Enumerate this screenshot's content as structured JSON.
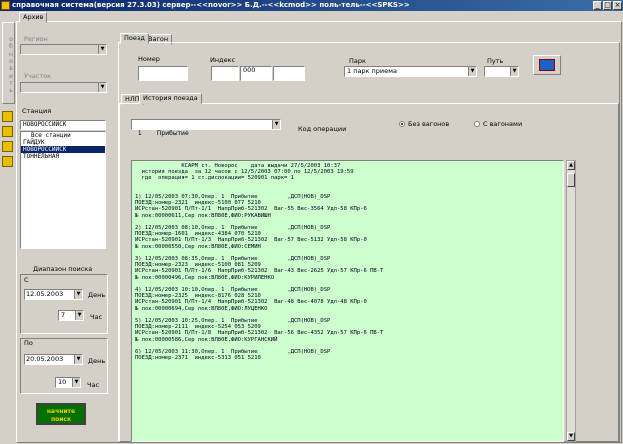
{
  "window": {
    "title": "справочная система(версия 27.3.03) сервер--<<novor>> Б.Д.--<<kcmod>> поль-тель--<<SPKS>>",
    "min": "_",
    "max": "□",
    "close": "×"
  },
  "top_tabs": [
    "Архив"
  ],
  "sidebar": {
    "vertical_button": [
      "о",
      "б",
      "н",
      "о",
      "в",
      "и",
      "т",
      "ь"
    ],
    "region_label": "Регион",
    "area_label": "Участок",
    "station_label": "Станция",
    "station_value": "НОВОРОССИЙСК",
    "stations": [
      "Все станции",
      "ГАЙДУК",
      "НОВОРОССИЙСК",
      "ТОННЕЛЬНАЯ"
    ],
    "selected_station_index": 2,
    "range_label": "Диапазон поиска",
    "from_label": "С",
    "from_date": "12.05.2003",
    "day_label_1": "День",
    "from_hour": "7",
    "hour_label_1": "Час",
    "to_label": "По",
    "to_date": "20.05.2003",
    "day_label_2": "День",
    "to_hour": "10",
    "hour_label_2": "Час",
    "find_button": "начните поиск"
  },
  "main_tabs": [
    "Поезд",
    "Вагон"
  ],
  "train": {
    "number_label": "Номер",
    "number_value": "",
    "index_label": "Индекс",
    "index_part1": "",
    "index_part2": "000",
    "index_part3": "",
    "park_label": "Парк",
    "park_value": "1 парк приема",
    "path_label": "Путь",
    "path_value": ""
  },
  "sub_tabs": [
    "НЛП",
    "История поезда"
  ],
  "operation": {
    "value": "1        Прибытие",
    "label": "Код операции",
    "radio_without": "Без вагонов",
    "radio_with": "С вагонами",
    "selected": "without"
  },
  "report_lines": [
    "              КСАРМ ст. Новорос    дата выдачи 27/5/2003 10:37",
    "  история поезда  за 12 часов с 12/5/2003 07:00 по 12/5/2003 19:59",
    "  где  операция= 1 ст.дислокации= 520901 парк= 1",
    "",
    "",
    "1) 12/05/2003 07:30,Опер. 1  Прибытие         ,ДСП(НОВ)_DSP",
    "ПОЕЗД:номер-2321  индекс-5100 077 5210",
    "ИСРстан-520901 П/Пт-1/1  НапрПриб-521302  Ваг-55 Вес-3564 Удл-58 КПр-6",
    "№ лок:00000611,Сер лок:ВЛ80Е,ФИО:РУКАВИШН",
    "",
    "2) 12/05/2003 08:10,Опер. 1  Прибытие         ,ДСП(НОВ)_DSP",
    "ПОЕЗД:номер-1601  индекс-4384 070 5210",
    "ИСРстан-520901 П/Пт-1/3  НапрПриб-521302  Ваг-57 Вес-5132 Удл-58 КПр-0",
    "№ лок:00000550,Сер лок:ВЛ80Е,ФИО:СЕМИН",
    "",
    "3) 12/05/2003 08:35,Опер. 1  Прибытие         ,ДСП(НОВ)_DSP",
    "ПОЕЗД:номер-2323  индекс-5100 081 5209",
    "ИСРстан-520901 П/Пт-1/6  НапрПриб-521302  Ваг-43 Вес-2625 Удл-57 КПр-6 ПВ-Т",
    "№ лок:00000496,Сер лок:ВЛ80Е,ФИО:КУРИЛЕНКО",
    "",
    "4) 12/05/2003 10:10,Опер. 1  Прибытие         ,ДСП(НОВ)_DSP",
    "ПОЕЗД:номер-2325  индекс-8176 028 5210",
    "ИСРстан-520901 П/Пт-1/4  НапрПриб-521302  Ваг-48 Вес-4078 Удл-48 КПр-0",
    "№ лок:00000694,Сер лок:ВЛ80Е,ФИО:ЛУЦЕНКО",
    "",
    "5) 12/05/2003 10:25,Опер. 1  Прибытие         ,ДСП(НОВ)_DSP",
    "ПОЕЗД:номер-2111  индекс-5254 053 5209",
    "ИСРстан-520901 П/Пт-1/8  НапрПриб-521302  Ваг-56 Вес-4352 Удл-57 КПр-6 ПВ-Т",
    "№ лок:00000586,Сер лок:ВЛ80Е,ФИО:КУРГАНСКИЙ",
    "",
    "6) 12/05/2003 11:30,Опер. 1  Прибытие         ,ДСП(НОВ)_DSP",
    "ПОЕЗД:номер-2371  индекс-5313 051 5210"
  ],
  "colors": {
    "report_bg": "#ccffcc",
    "window_bg": "#d4d0c8",
    "title_bar": "#0a246a",
    "find_button_bg": "#007000",
    "find_button_text": "#f0d000"
  }
}
